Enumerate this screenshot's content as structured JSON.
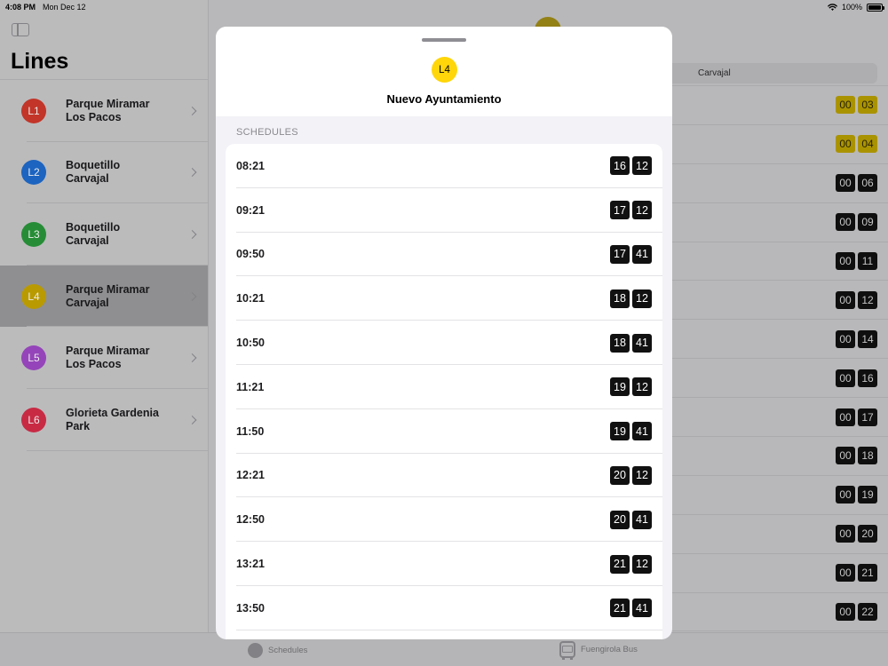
{
  "status_bar": {
    "time": "4:08 PM",
    "date": "Mon Dec 12",
    "battery": "100%"
  },
  "sidebar": {
    "title": "Lines",
    "lines": [
      {
        "badge": "L1",
        "color": "#d33a2c",
        "name1": "Parque Miramar",
        "name2": "Los Pacos"
      },
      {
        "badge": "L2",
        "color": "#1f6dd1",
        "name1": "Boquetillo",
        "name2": "Carvajal"
      },
      {
        "badge": "L3",
        "color": "#2a9a3b",
        "name1": "Boquetillo",
        "name2": "Carvajal"
      },
      {
        "badge": "L4",
        "color": "#c9a800",
        "name1": "Parque Miramar",
        "name2": "Carvajal"
      },
      {
        "badge": "L5",
        "color": "#a24bc9",
        "name1": "Parque Miramar",
        "name2": "Los Pacos"
      },
      {
        "badge": "L6",
        "color": "#d92e4a",
        "name1": "Glorieta Gardenia",
        "name2": "Park"
      }
    ]
  },
  "detail": {
    "segment_label": "Carvajal",
    "rows": [
      {
        "h": "00",
        "m": "03",
        "highlight": true
      },
      {
        "h": "00",
        "m": "04",
        "highlight": true
      },
      {
        "h": "00",
        "m": "06",
        "highlight": false
      },
      {
        "h": "00",
        "m": "09",
        "highlight": false
      },
      {
        "h": "00",
        "m": "11",
        "highlight": false
      },
      {
        "h": "00",
        "m": "12",
        "highlight": false
      },
      {
        "h": "00",
        "m": "14",
        "highlight": false
      },
      {
        "h": "00",
        "m": "16",
        "highlight": false
      },
      {
        "h": "00",
        "m": "17",
        "highlight": false
      },
      {
        "h": "00",
        "m": "18",
        "highlight": false
      },
      {
        "h": "00",
        "m": "19",
        "highlight": false
      },
      {
        "h": "00",
        "m": "20",
        "highlight": false
      },
      {
        "h": "00",
        "m": "21",
        "highlight": false
      },
      {
        "h": "00",
        "m": "22",
        "highlight": false
      }
    ]
  },
  "tab_bar": {
    "schedules_label": "Schedules",
    "bus_label": "Fuengirola Bus"
  },
  "sheet": {
    "badge": "L4",
    "badge_color": "#ffd60a",
    "stop_name": "Nuevo Ayuntamiento",
    "section_title": "SCHEDULES",
    "schedules": [
      {
        "time": "08:21",
        "h": "16",
        "m": "12"
      },
      {
        "time": "09:21",
        "h": "17",
        "m": "12"
      },
      {
        "time": "09:50",
        "h": "17",
        "m": "41"
      },
      {
        "time": "10:21",
        "h": "18",
        "m": "12"
      },
      {
        "time": "10:50",
        "h": "18",
        "m": "41"
      },
      {
        "time": "11:21",
        "h": "19",
        "m": "12"
      },
      {
        "time": "11:50",
        "h": "19",
        "m": "41"
      },
      {
        "time": "12:21",
        "h": "20",
        "m": "12"
      },
      {
        "time": "12:50",
        "h": "20",
        "m": "41"
      },
      {
        "time": "13:21",
        "h": "21",
        "m": "12"
      },
      {
        "time": "13:50",
        "h": "21",
        "m": "41"
      }
    ]
  },
  "icons": {
    "sidebar_toggle": "sidebar-toggle-icon",
    "chevron": "chevron-right-icon",
    "wifi": "wifi-icon",
    "battery": "battery-icon",
    "bus": "bus-icon"
  }
}
